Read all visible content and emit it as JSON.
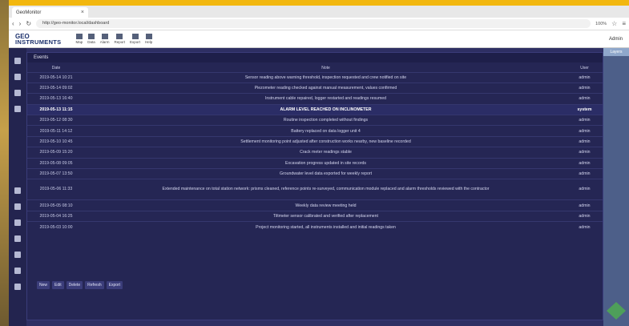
{
  "browser": {
    "tab_title": "GeoMonitor",
    "url": "http://geo-monitor.local/dashboard",
    "zoom": "100%"
  },
  "app": {
    "logo_line1": "GEO",
    "logo_line2": "INSTRUMENTS",
    "toolbar": [
      "Map",
      "Data",
      "Alarm",
      "Report",
      "Export",
      "Help"
    ],
    "user": "Admin"
  },
  "panel": {
    "label": "Layers"
  },
  "dialog": {
    "title": "Events",
    "columns": [
      "Date",
      "Note",
      "User"
    ],
    "rows": [
      {
        "date": "2019-05-14 10:21",
        "note": "Sensor reading above warning threshold, inspection requested and crew notified on site",
        "user": "admin",
        "hl": false,
        "tall": false
      },
      {
        "date": "2019-05-14 09:02",
        "note": "Piezometer reading checked against manual measurement, values confirmed",
        "user": "admin",
        "hl": false,
        "tall": false
      },
      {
        "date": "2019-05-13 16:40",
        "note": "Instrument cable repaired, logger restarted and readings resumed",
        "user": "admin",
        "hl": false,
        "tall": false
      },
      {
        "date": "2019-05-13 11:15",
        "note": "ALARM LEVEL REACHED ON INCLINOMETER",
        "user": "system",
        "hl": true,
        "tall": false
      },
      {
        "date": "2019-05-12 08:30",
        "note": "Routine inspection completed without findings",
        "user": "admin",
        "hl": false,
        "tall": false
      },
      {
        "date": "2019-05-11 14:12",
        "note": "Battery replaced on data logger unit 4",
        "user": "admin",
        "hl": false,
        "tall": false
      },
      {
        "date": "2019-05-10 10:45",
        "note": "Settlement monitoring point adjusted after construction works nearby, new baseline recorded",
        "user": "admin",
        "hl": false,
        "tall": false
      },
      {
        "date": "2019-05-09 15:20",
        "note": "Crack meter readings stable",
        "user": "admin",
        "hl": false,
        "tall": false
      },
      {
        "date": "2019-05-08 09:05",
        "note": "Excavation progress updated in site records",
        "user": "admin",
        "hl": false,
        "tall": false
      },
      {
        "date": "2019-05-07 13:50",
        "note": "Groundwater level data exported for weekly report",
        "user": "admin",
        "hl": false,
        "tall": false
      },
      {
        "date": "2019-05-06 11:33",
        "note": "Extended maintenance on total station network: prisms cleaned, reference points re-surveyed, communication module replaced and alarm thresholds reviewed with the contractor",
        "user": "admin",
        "hl": false,
        "tall": true
      },
      {
        "date": "2019-05-05 08:10",
        "note": "Weekly data review meeting held",
        "user": "admin",
        "hl": false,
        "tall": false
      },
      {
        "date": "2019-05-04 16:25",
        "note": "Tiltmeter sensor calibrated and verified after replacement",
        "user": "admin",
        "hl": false,
        "tall": false
      },
      {
        "date": "2019-05-03 10:00",
        "note": "Project monitoring started, all instruments installed and initial readings taken",
        "user": "admin",
        "hl": false,
        "tall": false
      }
    ],
    "buttons": [
      "New",
      "Edit",
      "Delete",
      "Refresh",
      "Export"
    ]
  }
}
